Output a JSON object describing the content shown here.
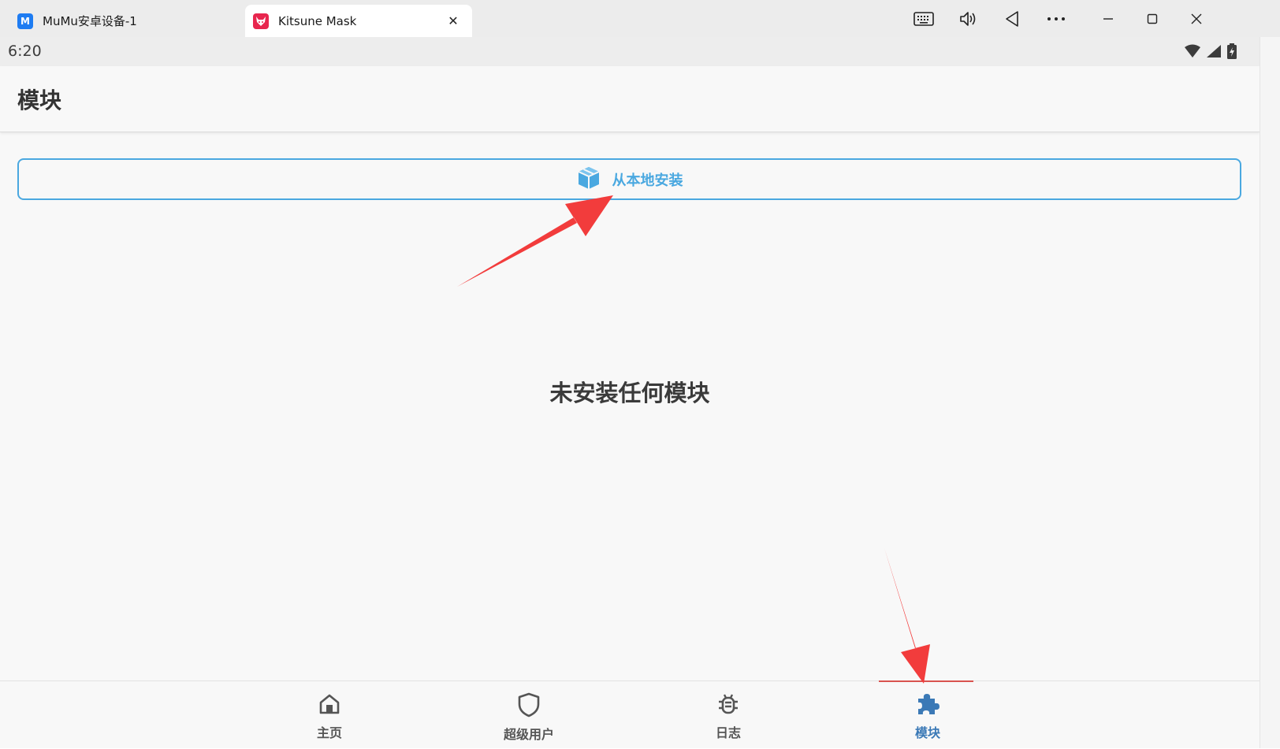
{
  "window": {
    "tabs": [
      {
        "label": "MuMu安卓设备-1",
        "icon": "mumu-icon",
        "active": false
      },
      {
        "label": "Kitsune Mask",
        "icon": "kitsune-fox-icon",
        "active": true
      }
    ],
    "controls": [
      "keyboard-icon",
      "volume-icon",
      "back-icon",
      "more-icon",
      "minimize-icon",
      "maximize-icon",
      "close-icon"
    ]
  },
  "statusbar": {
    "time": "6:20",
    "icons": [
      "wifi-icon",
      "signal-icon",
      "battery-icon"
    ]
  },
  "app": {
    "title": "模块",
    "install_button": {
      "label": "从本地安装",
      "icon": "package-icon"
    },
    "empty_message": "未安装任何模块",
    "nav": [
      {
        "label": "主页",
        "icon": "home-icon",
        "active": false
      },
      {
        "label": "超级用户",
        "icon": "shield-icon",
        "active": false
      },
      {
        "label": "日志",
        "icon": "bug-icon",
        "active": false
      },
      {
        "label": "模块",
        "icon": "puzzle-icon",
        "active": true
      }
    ],
    "accent_color": "#4aa8e0",
    "active_nav_color": "#3b79b6"
  },
  "annotations": {
    "arrow_color": "#f23c3c",
    "arrows": [
      "pointing to install-button",
      "pointing to nav modules"
    ]
  }
}
